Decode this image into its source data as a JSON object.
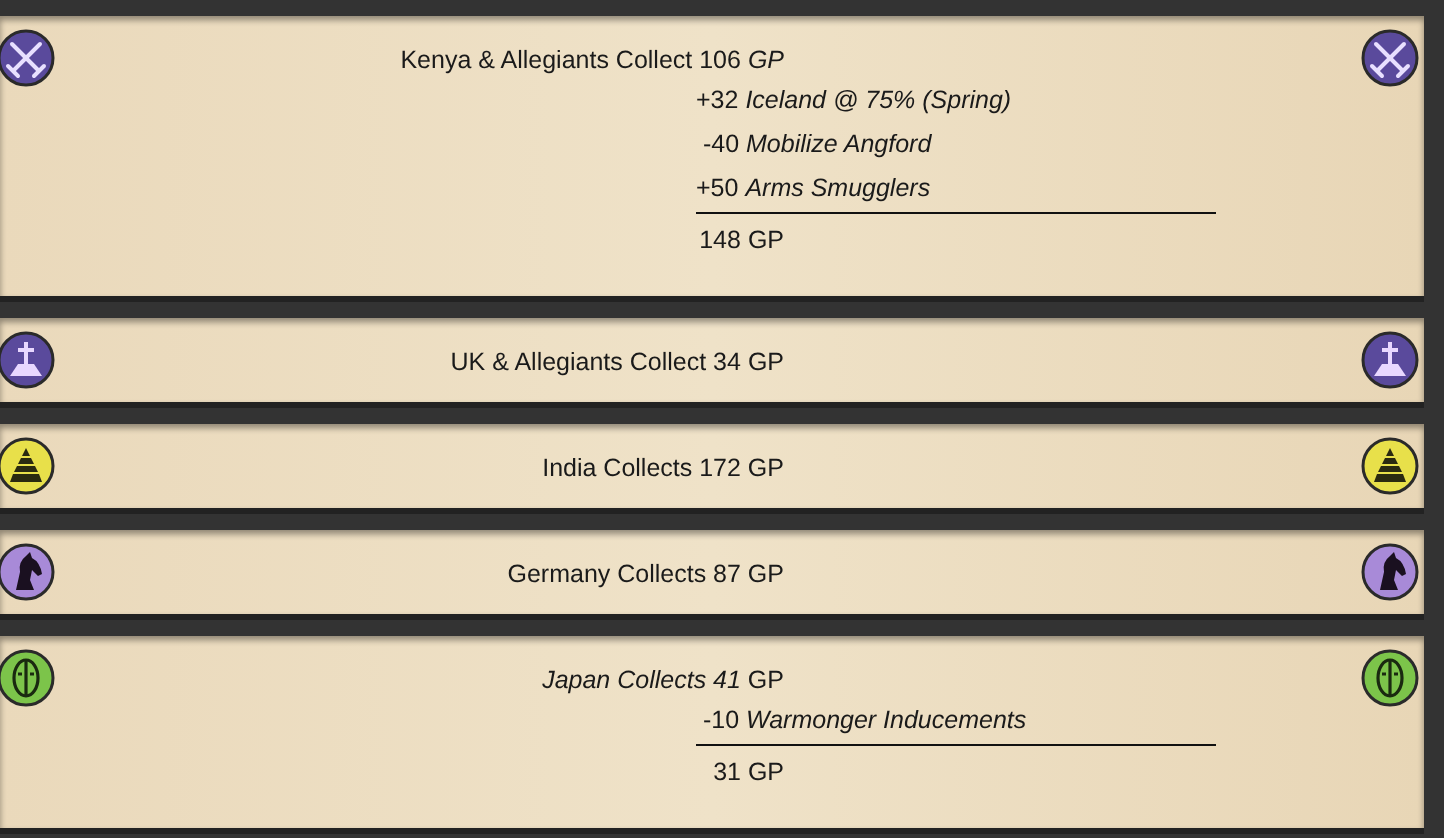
{
  "panels": [
    {
      "header": "Kenya & Allegiants Collect 106 *GP*",
      "kind": "swords",
      "color": "#5a4a9c",
      "adjustments": [
        "+32 *Iceland @ 75% (Spring)*",
        " -40 *Mobilize Angford*",
        "+50 *Arms Smugglers*"
      ],
      "total": "148 GP"
    },
    {
      "header": "UK & Allegiants Collect 34 GP",
      "kind": "cross",
      "color": "#5a4a9c"
    },
    {
      "header": "India Collects 172 GP",
      "kind": "pyramid",
      "color": "#e8e04a"
    },
    {
      "header": "Germany Collects 87 GP",
      "kind": "horse",
      "color": "#a88ad8"
    },
    {
      "header": "*Japan Collects 41* GP",
      "kind": "mask",
      "color": "#7cc44a",
      "adjustments": [
        " -10 *Warmonger Inducements*"
      ],
      "total": "31 GP"
    }
  ]
}
